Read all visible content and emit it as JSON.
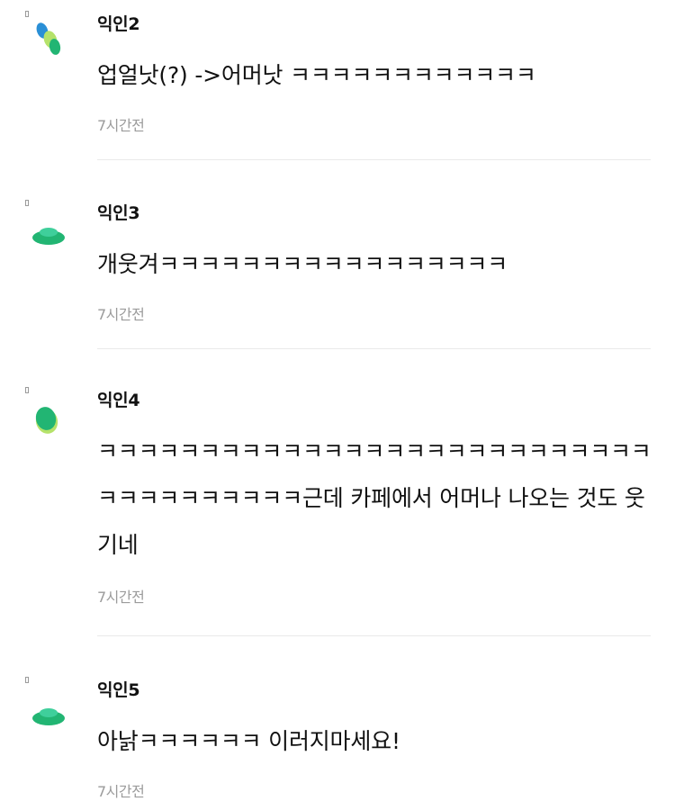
{
  "colors": {
    "avatar_green": "#22b573",
    "avatar_mint": "#3fcf9b",
    "avatar_blue": "#2a8fd6",
    "avatar_lime": "#b5e26a",
    "meta_gray": "#9b9b9b"
  },
  "comments": [
    {
      "author": "익인2",
      "text": "업얼낫(?) ->어머낫 ㅋㅋㅋㅋㅋㅋㅋㅋㅋㅋㅋㅋ",
      "time": "7시간전",
      "avatar_icon": "leaf-cluster-avatar-icon"
    },
    {
      "author": "익인3",
      "text": "개웃겨ㅋㅋㅋㅋㅋㅋㅋㅋㅋㅋㅋㅋㅋㅋㅋㅋㅋ",
      "time": "7시간전",
      "avatar_icon": "cap-avatar-icon"
    },
    {
      "author": "익인4",
      "text": "ㅋㅋㅋㅋㅋㅋㅋㅋㅋㅋㅋㅋㅋㅋㅋㅋㅋㅋㅋㅋㅋㅋㅋㅋㅋㅋㅋㅋㅋㅋㅋㅋㅋㅋㅋㅋㅋ근데 카페에서 어머나 나오는 것도 웃기네",
      "time": "7시간전",
      "avatar_icon": "bean-avatar-icon"
    },
    {
      "author": "익인5",
      "text": "아낡ㅋㅋㅋㅋㅋㅋ 이러지마세요!",
      "time": "7시간전",
      "avatar_icon": "cap-avatar-icon"
    }
  ]
}
